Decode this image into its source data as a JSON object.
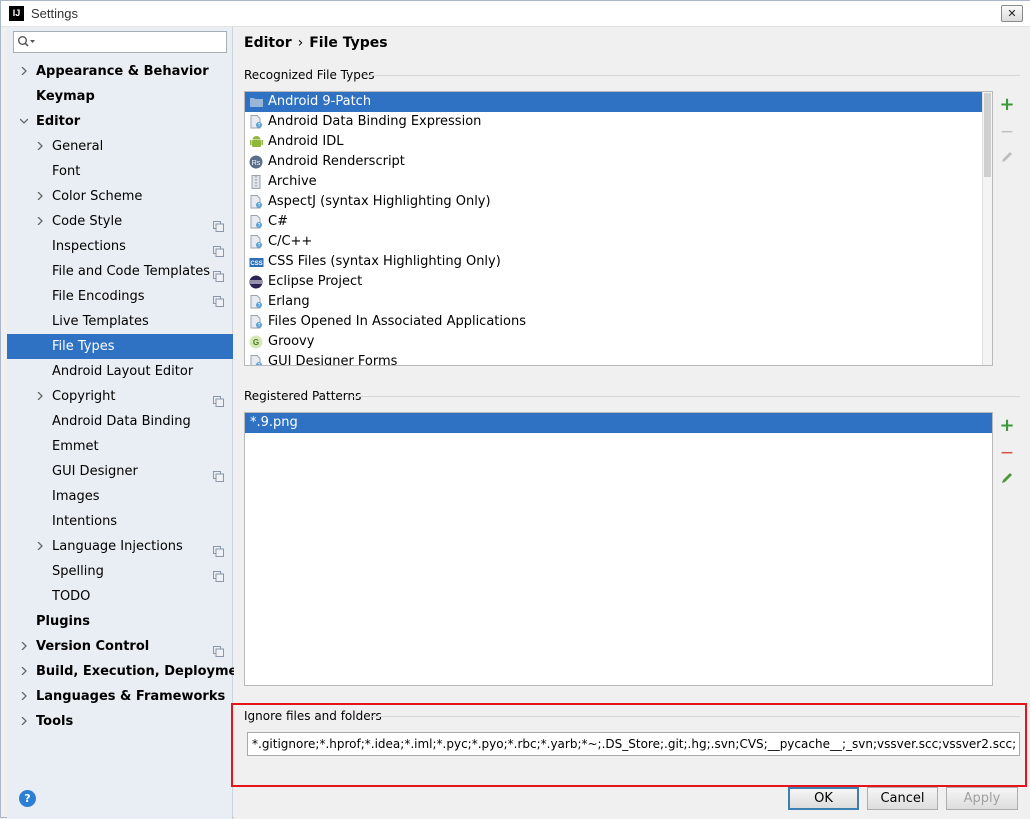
{
  "window": {
    "title": "Settings",
    "app_icon_text": "IJ",
    "close_glyph": "✕"
  },
  "search": {
    "placeholder": "",
    "value": ""
  },
  "sidebar": {
    "items": [
      {
        "label": "Appearance & Behavior",
        "level": 0,
        "bold": true,
        "expander": "collapsed"
      },
      {
        "label": "Keymap",
        "level": 0,
        "bold": true,
        "expander": "none"
      },
      {
        "label": "Editor",
        "level": 0,
        "bold": true,
        "expander": "expanded"
      },
      {
        "label": "General",
        "level": 1,
        "expander": "collapsed"
      },
      {
        "label": "Font",
        "level": 1,
        "expander": "none"
      },
      {
        "label": "Color Scheme",
        "level": 1,
        "expander": "collapsed"
      },
      {
        "label": "Code Style",
        "level": 1,
        "expander": "collapsed",
        "project_icon": true
      },
      {
        "label": "Inspections",
        "level": 1,
        "expander": "none",
        "project_icon": true
      },
      {
        "label": "File and Code Templates",
        "level": 1,
        "expander": "none",
        "project_icon": true
      },
      {
        "label": "File Encodings",
        "level": 1,
        "expander": "none",
        "project_icon": true
      },
      {
        "label": "Live Templates",
        "level": 1,
        "expander": "none"
      },
      {
        "label": "File Types",
        "level": 1,
        "expander": "none",
        "selected": true
      },
      {
        "label": "Android Layout Editor",
        "level": 1,
        "expander": "none"
      },
      {
        "label": "Copyright",
        "level": 1,
        "expander": "collapsed",
        "project_icon": true
      },
      {
        "label": "Android Data Binding",
        "level": 1,
        "expander": "none"
      },
      {
        "label": "Emmet",
        "level": 1,
        "expander": "none"
      },
      {
        "label": "GUI Designer",
        "level": 1,
        "expander": "none",
        "project_icon": true
      },
      {
        "label": "Images",
        "level": 1,
        "expander": "none"
      },
      {
        "label": "Intentions",
        "level": 1,
        "expander": "none"
      },
      {
        "label": "Language Injections",
        "level": 1,
        "expander": "collapsed",
        "project_icon": true
      },
      {
        "label": "Spelling",
        "level": 1,
        "expander": "none",
        "project_icon": true
      },
      {
        "label": "TODO",
        "level": 1,
        "expander": "none"
      },
      {
        "label": "Plugins",
        "level": 0,
        "bold": true,
        "expander": "none"
      },
      {
        "label": "Version Control",
        "level": 0,
        "bold": true,
        "expander": "collapsed",
        "project_icon": true
      },
      {
        "label": "Build, Execution, Deployment",
        "level": 0,
        "bold": true,
        "expander": "collapsed"
      },
      {
        "label": "Languages & Frameworks",
        "level": 0,
        "bold": true,
        "expander": "collapsed"
      },
      {
        "label": "Tools",
        "level": 0,
        "bold": true,
        "expander": "collapsed"
      }
    ]
  },
  "breadcrumb": {
    "parent": "Editor",
    "separator": "›",
    "current": "File Types"
  },
  "recognized": {
    "title": "Recognized File Types",
    "items": [
      {
        "label": "Android 9-Patch",
        "icon": "folder-icon",
        "selected": true
      },
      {
        "label": "Android Data Binding Expression",
        "icon": "unknown-file-icon"
      },
      {
        "label": "Android IDL",
        "icon": "android-icon"
      },
      {
        "label": "Android Renderscript",
        "icon": "renderscript-icon",
        "badge": "Rs"
      },
      {
        "label": "Archive",
        "icon": "archive-icon"
      },
      {
        "label": "AspectJ (syntax Highlighting Only)",
        "icon": "unknown-file-icon"
      },
      {
        "label": "C#",
        "icon": "unknown-file-icon"
      },
      {
        "label": "C/C++",
        "icon": "unknown-file-icon"
      },
      {
        "label": "CSS Files (syntax Highlighting Only)",
        "icon": "css-icon",
        "badge": "CSS"
      },
      {
        "label": "Eclipse Project",
        "icon": "eclipse-icon"
      },
      {
        "label": "Erlang",
        "icon": "unknown-file-icon"
      },
      {
        "label": "Files Opened In Associated Applications",
        "icon": "unknown-file-icon"
      },
      {
        "label": "Groovy",
        "icon": "groovy-icon",
        "badge": "G"
      },
      {
        "label": "GUI Designer Forms",
        "icon": "unknown-file-icon"
      }
    ]
  },
  "patterns": {
    "title": "Registered Patterns",
    "items": [
      {
        "label": "*.9.png",
        "selected": true
      }
    ]
  },
  "toolbar": {
    "add_glyph": "+",
    "remove_glyph": "—"
  },
  "ignore": {
    "title": "Ignore files and folders",
    "value": "*.gitignore;*.hprof;*.idea;*.iml;*.pyc;*.pyo;*.rbc;*.yarb;*~;.DS_Store;.git;.hg;.svn;CVS;__pycache__;_svn;vssver.scc;vssver2.scc;"
  },
  "buttons": {
    "help": "?",
    "ok": "OK",
    "cancel": "Cancel",
    "apply": "Apply"
  },
  "colors": {
    "selection": "#2f72c3",
    "highlight_border": "#e8141c",
    "add": "#3a9a3a",
    "remove": "#d9534f"
  }
}
